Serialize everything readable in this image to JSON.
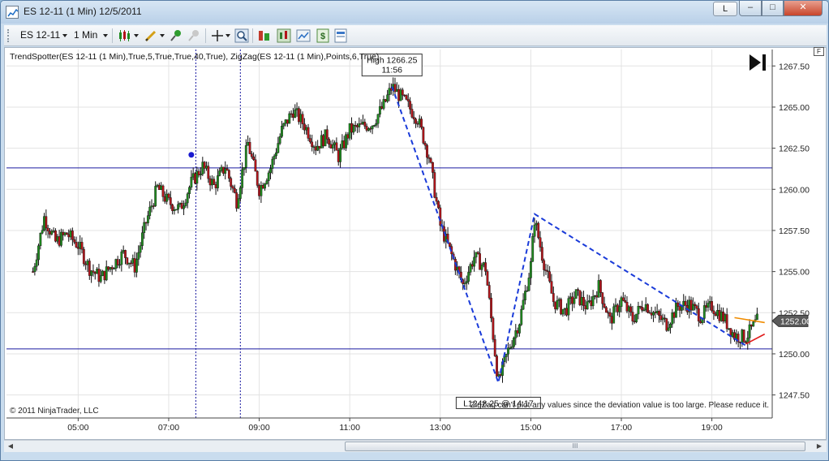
{
  "window": {
    "title": "ES 12-11 (1 Min)  12/5/2011",
    "link_button": "L",
    "min_glyph": "–",
    "max_glyph": "□",
    "close_glyph": "✕"
  },
  "toolbar": {
    "instrument": "ES 12-11",
    "interval": "1 Min",
    "icons": [
      "bar-type-icon",
      "drawing-tool-icon",
      "crosshair-icon",
      "zoom-icon",
      "indicators-icon",
      "strategies-icon",
      "properties-icon",
      "data-box-icon"
    ]
  },
  "chart": {
    "indicator_label": "TrendSpotter(ES 12-11 (1 Min),True,5,True,True,40,True), ZigZag(ES 12-11 (1 Min),Points,6,True)",
    "copyright": "© 2011 NinjaTrader, LLC",
    "warning": "ZigZag can't plot any values since the deviation value is too large. Please reduce it.",
    "f_label": "F",
    "scroll_grip": "III",
    "colors": {
      "up_candle": "#1f8a1f",
      "down_candle": "#b3141a",
      "zigzag": "#1a3bd9",
      "level_lines": "#1a1aa0",
      "orange_line": "#f08c00",
      "red_line": "#e01b1b"
    }
  },
  "chart_data": {
    "type": "candlestick",
    "title": "",
    "xlabel": "",
    "ylabel": "",
    "ylim": [
      1246.1,
      1268.5
    ],
    "x_ticks": [
      "05:00",
      "07:00",
      "09:00",
      "11:00",
      "13:00",
      "15:00",
      "17:00",
      "19:00"
    ],
    "y_ticks": [
      "1267.50",
      "1265.00",
      "1262.50",
      "1260.00",
      "1257.50",
      "1255.00",
      "1252.50",
      "1250.00",
      "1247.50"
    ],
    "grid": true,
    "path_points": [
      [
        "04:00",
        1255.0
      ],
      [
        "04:15",
        1258.3
      ],
      [
        "04:30",
        1256.8
      ],
      [
        "04:45",
        1257.3
      ],
      [
        "05:00",
        1256.6
      ],
      [
        "05:15",
        1255.2
      ],
      [
        "05:30",
        1254.6
      ],
      [
        "05:45",
        1255.4
      ],
      [
        "06:00",
        1256.1
      ],
      [
        "06:15",
        1255.3
      ],
      [
        "06:30",
        1258.0
      ],
      [
        "06:45",
        1260.1
      ],
      [
        "07:00",
        1259.2
      ],
      [
        "07:15",
        1258.8
      ],
      [
        "07:30",
        1260.4
      ],
      [
        "07:45",
        1261.4
      ],
      [
        "08:00",
        1260.2
      ],
      [
        "08:15",
        1261.4
      ],
      [
        "08:30",
        1259.3
      ],
      [
        "08:45",
        1262.8
      ],
      [
        "09:00",
        1260.0
      ],
      [
        "09:15",
        1261.3
      ],
      [
        "09:30",
        1263.6
      ],
      [
        "09:45",
        1264.8
      ],
      [
        "10:00",
        1263.9
      ],
      [
        "10:15",
        1262.6
      ],
      [
        "10:30",
        1263.3
      ],
      [
        "10:45",
        1262.0
      ],
      [
        "11:00",
        1263.6
      ],
      [
        "11:15",
        1263.8
      ],
      [
        "11:30",
        1264.0
      ],
      [
        "11:45",
        1265.1
      ],
      [
        "11:56",
        1266.25
      ],
      [
        "12:15",
        1265.2
      ],
      [
        "12:30",
        1264.3
      ],
      [
        "12:45",
        1262.0
      ],
      [
        "13:00",
        1257.8
      ],
      [
        "13:15",
        1256.0
      ],
      [
        "13:30",
        1254.2
      ],
      [
        "13:45",
        1255.9
      ],
      [
        "14:00",
        1255.2
      ],
      [
        "14:17",
        1248.25
      ],
      [
        "14:30",
        1250.2
      ],
      [
        "14:45",
        1252.0
      ],
      [
        "15:00",
        1255.4
      ],
      [
        "15:05",
        1258.2
      ],
      [
        "15:15",
        1256.0
      ],
      [
        "15:30",
        1253.2
      ],
      [
        "15:45",
        1252.6
      ],
      [
        "16:00",
        1253.6
      ],
      [
        "16:15",
        1252.8
      ],
      [
        "16:30",
        1254.1
      ],
      [
        "16:45",
        1252.0
      ],
      [
        "17:00",
        1253.3
      ],
      [
        "17:15",
        1252.1
      ],
      [
        "17:30",
        1253.1
      ],
      [
        "17:45",
        1252.4
      ],
      [
        "18:00",
        1251.8
      ],
      [
        "18:15",
        1252.9
      ],
      [
        "18:30",
        1253.0
      ],
      [
        "18:45",
        1252.3
      ],
      [
        "19:00",
        1252.9
      ],
      [
        "19:15",
        1252.2
      ],
      [
        "19:30",
        1251.1
      ],
      [
        "19:45",
        1251.0
      ],
      [
        "20:00",
        1252.0
      ]
    ],
    "zigzag": [
      [
        "11:56",
        1266.25
      ],
      [
        "14:17",
        1248.25
      ],
      [
        "15:05",
        1258.5
      ],
      [
        "19:45",
        1250.5
      ]
    ],
    "horizontal_levels": [
      1261.3,
      1250.3
    ],
    "vertical_markers": [
      "07:36",
      "08:35"
    ],
    "blue_dot": [
      "07:30",
      1262.1
    ],
    "annotations": [
      {
        "label": "High 1266.25",
        "sublabel": "11:56",
        "time": "11:56",
        "price": 1266.25
      },
      {
        "label": "L1248.25 @ 14:17",
        "time": "14:17",
        "price": 1248.25
      }
    ],
    "trend_lines": [
      {
        "color": "orange",
        "from": [
          "19:30",
          1252.2
        ],
        "to": [
          "20:10",
          1251.9
        ]
      },
      {
        "color": "red",
        "from": [
          "19:45",
          1250.6
        ],
        "to": [
          "20:10",
          1251.2
        ]
      }
    ],
    "last_price": "1252.00"
  }
}
